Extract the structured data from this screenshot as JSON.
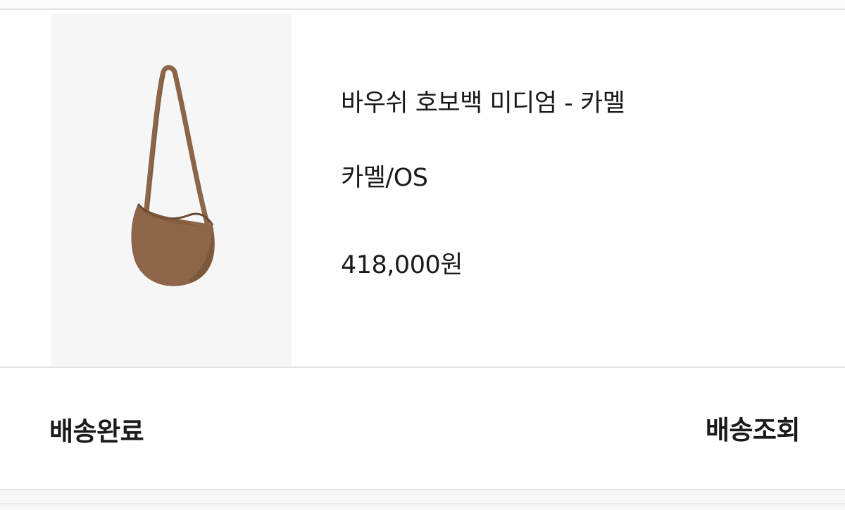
{
  "order_item": {
    "product_name": "바우쉬 호보백 미디엄 - 카멜",
    "option": "카멜/OS",
    "price": "418,000원",
    "image_icon": "hobo-bag-thumbnail",
    "bag_color": "#8d6548"
  },
  "footer": {
    "status": "배송완료",
    "track_button_label": "배송조회"
  }
}
